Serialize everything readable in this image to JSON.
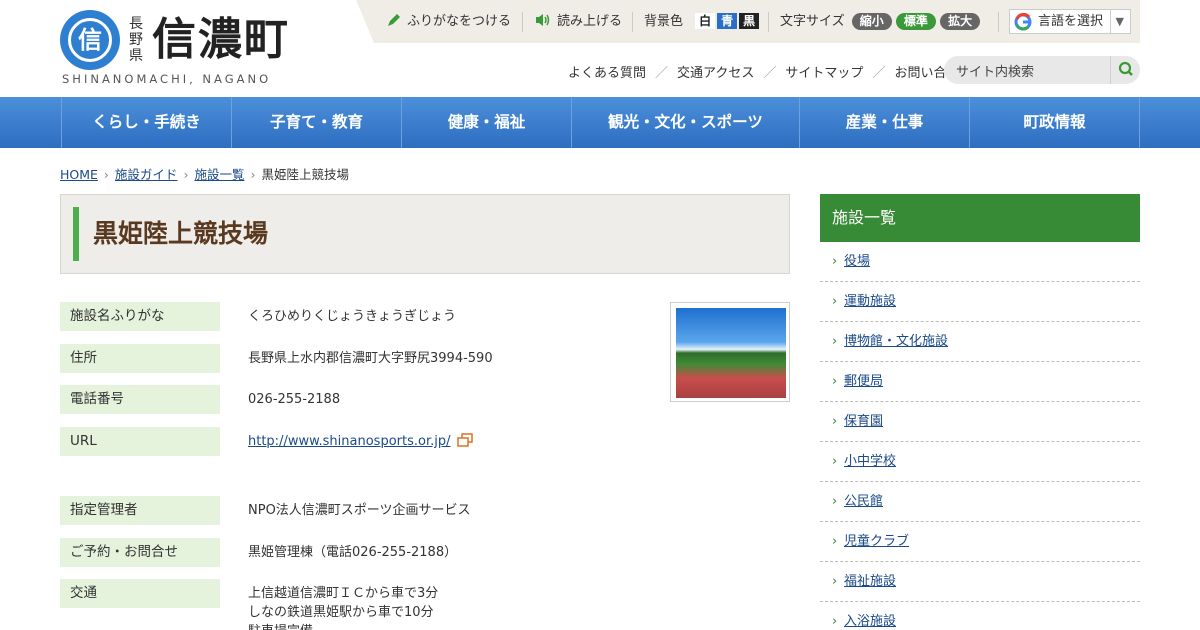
{
  "header": {
    "logo_glyph": "信",
    "logo_pref": "長野県",
    "logo_name": "信濃町",
    "logo_en": "SHINANOMACHI, NAGANO",
    "furigana": "ふりがなをつける",
    "read_aloud": "読み上げる",
    "bg_label": "背景色",
    "bg_white": "白",
    "bg_blue": "青",
    "bg_black": "黒",
    "fontsize_label": "文字サイズ",
    "font_small": "縮小",
    "font_normal": "標準",
    "font_large": "拡大",
    "language": "言語を選択",
    "sublinks": [
      "よくある質問",
      "交通アクセス",
      "サイトマップ",
      "お問い合わせ"
    ],
    "search_placeholder": "サイト内検索"
  },
  "nav": [
    "くらし・手続き",
    "子育て・教育",
    "健康・福祉",
    "観光・文化・スポーツ",
    "産業・仕事",
    "町政情報"
  ],
  "breadcrumb": [
    "HOME",
    "施設ガイド",
    "施設一覧",
    "黒姫陸上競技場"
  ],
  "page_title": "黒姫陸上競技場",
  "info": [
    {
      "label": "施設名ふりがな",
      "value": "くろひめりくじょうきょうぎじょう"
    },
    {
      "label": "住所",
      "value": "長野県上水内郡信濃町大字野尻3994-590"
    },
    {
      "label": "電話番号",
      "value": "026-255-2188"
    },
    {
      "label": "URL",
      "value": "http://www.shinanosports.or.jp/"
    },
    {
      "label": "指定管理者",
      "value": "NPO法人信濃町スポーツ企画サービス"
    },
    {
      "label": "ご予約・お問合せ",
      "value": "黒姫管理棟（電話026-255-2188）"
    },
    {
      "label": "交通",
      "lines": [
        "上信越道信濃町ＩＣから車で3分",
        "しなの鉄道黒姫駅から車で10分",
        "駐車場完備"
      ]
    }
  ],
  "sidebar": {
    "title": "施設一覧",
    "items": [
      "役場",
      "運動施設",
      "博物館・文化施設",
      "郵便局",
      "保育園",
      "小中学校",
      "公民館",
      "児童クラブ",
      "福祉施設",
      "入浴施設"
    ]
  },
  "colors": {
    "nav": "#3a7fd0",
    "accent_green": "#378a36",
    "label_bg": "#e5f3dc",
    "title_color": "#5a3921"
  }
}
